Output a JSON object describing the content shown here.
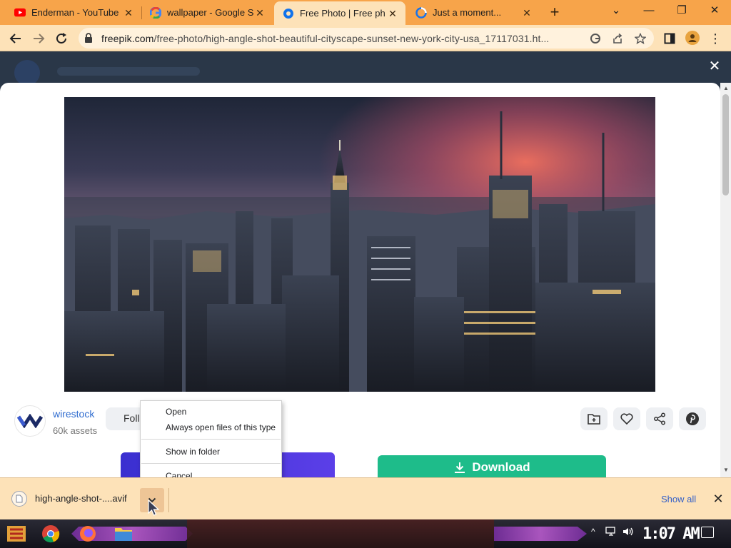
{
  "tabs": [
    {
      "title": "Enderman - YouTube",
      "favicon": "youtube-icon",
      "active": false
    },
    {
      "title": "wallpaper - Google Se",
      "favicon": "google-icon",
      "active": false
    },
    {
      "title": "Free Photo | Free ph",
      "favicon": "freepik-icon",
      "active": true
    },
    {
      "title": "Just a moment...",
      "favicon": "loading-icon",
      "active": false
    }
  ],
  "toolbar": {
    "url_host": "freepik.com",
    "url_path": "/free-photo/high-angle-shot-beautiful-cityscape-sunset-new-york-city-usa_17117031.ht..."
  },
  "author": {
    "name": "wirestock",
    "assets": "60k assets",
    "follow_label": "Foll"
  },
  "download_button_label": "Download",
  "context_menu": {
    "items": [
      "Open",
      "Always open files of this type",
      "Show in folder",
      "Cancel"
    ]
  },
  "download_shelf": {
    "filename": "high-angle-shot-....avif",
    "show_all": "Show all"
  },
  "taskbar": {
    "clock": "1:07 AM"
  },
  "colors": {
    "tabstrip": "#f7a44a",
    "toolbar": "#fde2b8",
    "download_green": "#1ebc8a",
    "link_blue": "#2f6ccf"
  }
}
